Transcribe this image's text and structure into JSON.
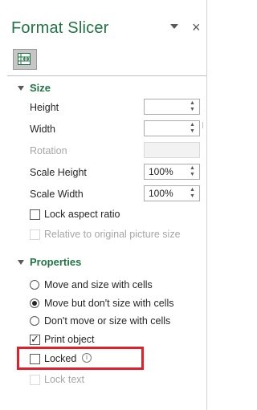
{
  "pane": {
    "title": "Format Slicer",
    "close_glyph": "×",
    "menu_icon": "chevron-down-icon",
    "tab_icon": "slicer-properties-icon"
  },
  "size_section": {
    "title": "Size",
    "height": {
      "label": "Height",
      "value": ""
    },
    "width": {
      "label": "Width",
      "value": ""
    },
    "rotation": {
      "label": "Rotation",
      "value": ""
    },
    "scale_height": {
      "label": "Scale Height",
      "value": "100%"
    },
    "scale_width": {
      "label": "Scale Width",
      "value": "100%"
    },
    "lock_aspect": {
      "label": "Lock aspect ratio",
      "checked": false
    },
    "relative_original": {
      "label": "Relative to original picture size",
      "checked": false
    }
  },
  "properties_section": {
    "title": "Properties",
    "radio_options": [
      {
        "label": "Move and size with cells",
        "selected": false
      },
      {
        "label": "Move but don't size with cells",
        "selected": true
      },
      {
        "label": "Don't move or size with cells",
        "selected": false
      }
    ],
    "print_object": {
      "label": "Print object",
      "checked": true
    },
    "locked": {
      "label": "Locked",
      "checked": false,
      "info_glyph": "i"
    },
    "lock_text": {
      "label": "Lock text",
      "checked": false
    }
  },
  "colors": {
    "accent": "#217346",
    "highlight": "#e0202a"
  }
}
